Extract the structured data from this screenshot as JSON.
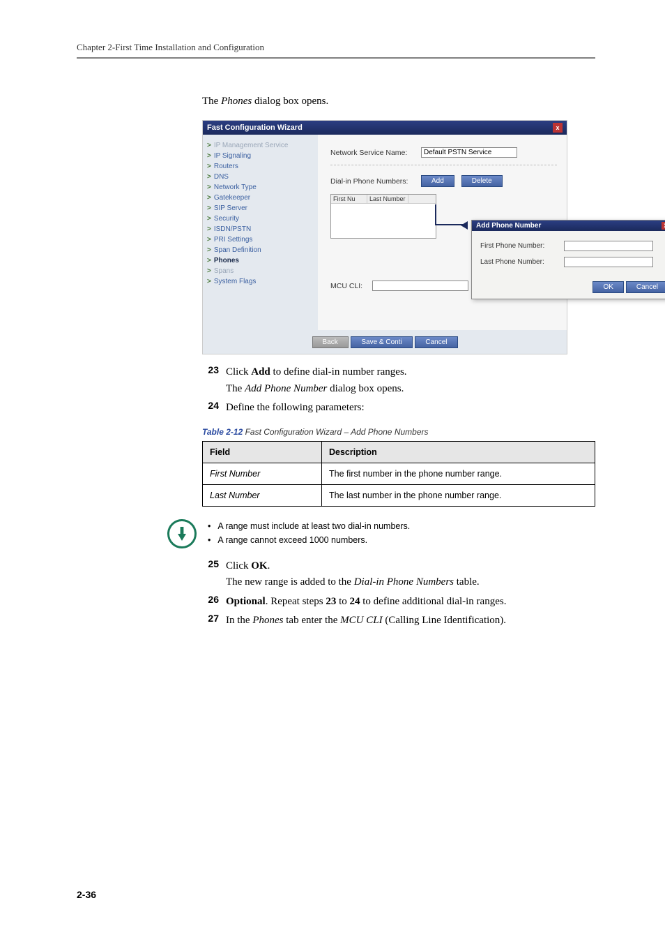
{
  "running_head": "Chapter 2-First Time Installation and Configuration",
  "intro": {
    "pre": "The ",
    "em": "Phones",
    "post": " dialog box opens."
  },
  "wizard": {
    "title": "Fast Configuration Wizard",
    "close": "x",
    "side_items": [
      {
        "label": "IP Management Service",
        "dim": true
      },
      {
        "label": "IP Signaling"
      },
      {
        "label": "Routers"
      },
      {
        "label": "DNS"
      },
      {
        "label": "Network Type"
      },
      {
        "label": "Gatekeeper"
      },
      {
        "label": "SIP Server"
      },
      {
        "label": "Security"
      },
      {
        "label": "ISDN/PSTN"
      },
      {
        "label": "PRI Settings"
      },
      {
        "label": "Span Definition"
      },
      {
        "label": "Phones",
        "bold": true
      },
      {
        "label": "Spans",
        "dim": true
      },
      {
        "label": "System Flags"
      }
    ],
    "net_service_label": "Network Service Name:",
    "net_service_value": "Default PSTN Service",
    "dialin_label": "Dial-in Phone Numbers:",
    "add_btn": "Add",
    "delete_btn": "Delete",
    "col1": "First Nu",
    "col2": "Last Number",
    "mcu_label": "MCU CLI:",
    "sub_title": "Add Phone Number",
    "sub_first": "First Phone Number:",
    "sub_last": "Last Phone Number:",
    "ok": "OK",
    "cancel": "Cancel",
    "back": "Back",
    "save": "Save & Conti",
    "foot_cancel": "Cancel"
  },
  "step23": {
    "num": "23",
    "a": "Click ",
    "b": "Add",
    "c": " to define dial-in number ranges.",
    "d_pre": "The ",
    "d_em": "Add Phone Number",
    "d_post": " dialog box opens."
  },
  "step24": {
    "num": "24",
    "a": "Define the following parameters:"
  },
  "table": {
    "caption_num": "Table 2-12",
    "caption_ttl": "  Fast Configuration Wizard – Add Phone Numbers",
    "h1": "Field",
    "h2": "Description",
    "rows": [
      {
        "f": "First Number",
        "d": "The first number in the phone number range."
      },
      {
        "f": "Last Number",
        "d": "The last number in the phone number range."
      }
    ]
  },
  "notes": [
    "A range must include at least two dial-in numbers.",
    "A range cannot exceed 1000 numbers."
  ],
  "step25": {
    "num": "25",
    "a": "Click ",
    "b": "OK",
    "c": ".",
    "d_pre": "The new range is added to the ",
    "d_em": "Dial-in Phone Numbers",
    "d_post": " table."
  },
  "step26": {
    "num": "26",
    "a": "Optional",
    "b": ". Repeat steps ",
    "c": "23",
    "d": " to ",
    "e": "24",
    "f": " to define additional dial-in ranges."
  },
  "step27": {
    "num": "27",
    "a": "In the ",
    "b": "Phones",
    "c": " tab enter the ",
    "d": "MCU CLI",
    "e": " (Calling Line Identification)."
  },
  "page_number": "2-36"
}
